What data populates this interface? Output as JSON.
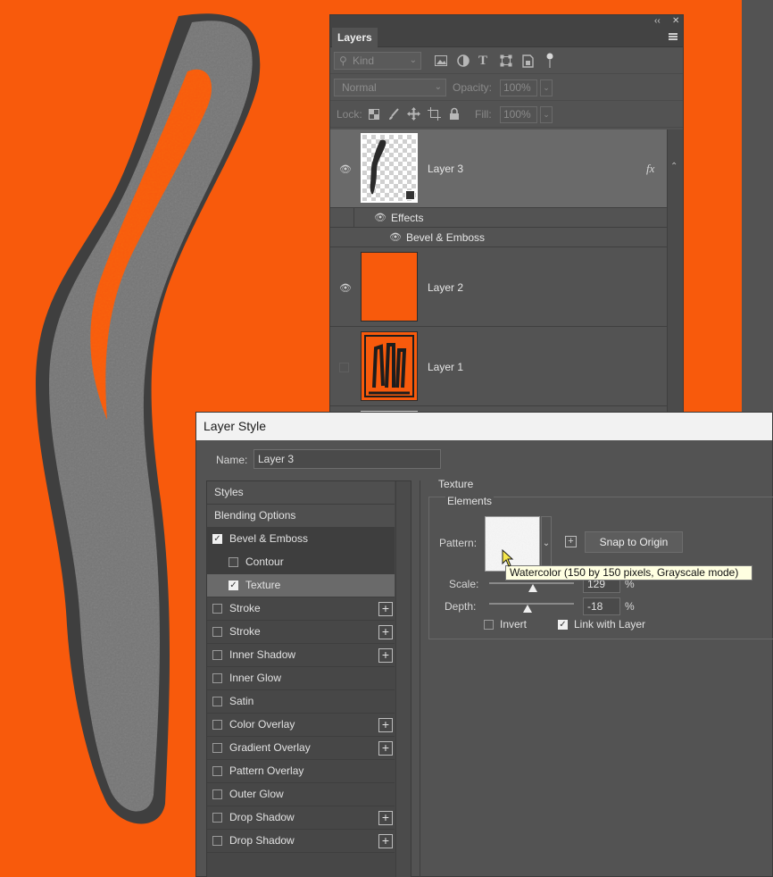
{
  "layers_panel": {
    "tab_label": "Layers",
    "collapse_glyph": "‹‹",
    "close_glyph": "✕",
    "kind_filter": "Kind",
    "blend_mode": "Normal",
    "opacity_label": "Opacity:",
    "opacity_value": "100%",
    "lock_label": "Lock:",
    "fill_label": "Fill:",
    "fill_value": "100%",
    "fx_label": "fx",
    "layers": [
      {
        "name": "Layer 3",
        "visible": true
      },
      {
        "name": "Layer 2",
        "visible": true
      },
      {
        "name": "Layer 1",
        "visible": false
      }
    ],
    "effects_label": "Effects",
    "effect_item": "Bevel & Emboss"
  },
  "dialog": {
    "title": "Layer Style",
    "name_label": "Name:",
    "name_value": "Layer 3",
    "styles_list": [
      {
        "label": "Styles",
        "type": "header"
      },
      {
        "label": "Blending Options",
        "type": "header"
      },
      {
        "label": "Bevel & Emboss",
        "checked": true,
        "plus": false
      },
      {
        "label": "Contour",
        "checked": false,
        "plus": false,
        "indent": true
      },
      {
        "label": "Texture",
        "checked": true,
        "plus": false,
        "indent": true,
        "selected": true
      },
      {
        "label": "Stroke",
        "checked": false,
        "plus": true
      },
      {
        "label": "Stroke",
        "checked": false,
        "plus": true
      },
      {
        "label": "Inner Shadow",
        "checked": false,
        "plus": true
      },
      {
        "label": "Inner Glow",
        "checked": false,
        "plus": false
      },
      {
        "label": "Satin",
        "checked": false,
        "plus": false
      },
      {
        "label": "Color Overlay",
        "checked": false,
        "plus": true
      },
      {
        "label": "Gradient Overlay",
        "checked": false,
        "plus": true
      },
      {
        "label": "Pattern Overlay",
        "checked": false,
        "plus": false
      },
      {
        "label": "Outer Glow",
        "checked": false,
        "plus": false
      },
      {
        "label": "Drop Shadow",
        "checked": false,
        "plus": true
      },
      {
        "label": "Drop Shadow",
        "checked": false,
        "plus": true
      }
    ],
    "texture": {
      "group_title": "Texture",
      "elements_title": "Elements",
      "pattern_label": "Pattern:",
      "snap_button": "Snap to Origin",
      "scale_label": "Scale:",
      "scale_value": "129",
      "scale_fraction": 0.52,
      "depth_label": "Depth:",
      "depth_value": "-18",
      "depth_fraction": 0.45,
      "percent": "%",
      "invert_label": "Invert",
      "invert_checked": false,
      "link_label": "Link with Layer",
      "link_checked": true
    },
    "tooltip": "Watercolor (150 by 150 pixels, Grayscale mode)"
  },
  "colors": {
    "canvas": "#f85a0c",
    "panel": "#535353",
    "shape": "#6e6e6e"
  }
}
